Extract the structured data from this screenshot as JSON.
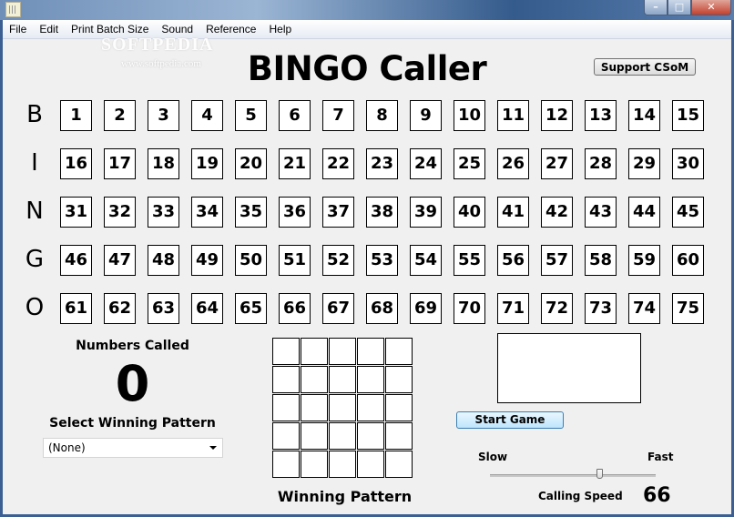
{
  "window": {
    "title_buttons": {
      "minimize": "–",
      "maximize": "□",
      "close": "✕"
    }
  },
  "watermark": {
    "brand": "SOFTPEDIA",
    "url": "www.softpedia.com"
  },
  "menu": [
    "File",
    "Edit",
    "Print Batch Size",
    "Sound",
    "Reference",
    "Help"
  ],
  "header": {
    "title": "BINGO Caller",
    "support_button": "Support CSoM"
  },
  "board": {
    "rows": [
      {
        "letter": "B",
        "numbers": [
          1,
          2,
          3,
          4,
          5,
          6,
          7,
          8,
          9,
          10,
          11,
          12,
          13,
          14,
          15
        ]
      },
      {
        "letter": "I",
        "numbers": [
          16,
          17,
          18,
          19,
          20,
          21,
          22,
          23,
          24,
          25,
          26,
          27,
          28,
          29,
          30
        ]
      },
      {
        "letter": "N",
        "numbers": [
          31,
          32,
          33,
          34,
          35,
          36,
          37,
          38,
          39,
          40,
          41,
          42,
          43,
          44,
          45
        ]
      },
      {
        "letter": "G",
        "numbers": [
          46,
          47,
          48,
          49,
          50,
          51,
          52,
          53,
          54,
          55,
          56,
          57,
          58,
          59,
          60
        ]
      },
      {
        "letter": "O",
        "numbers": [
          61,
          62,
          63,
          64,
          65,
          66,
          67,
          68,
          69,
          70,
          71,
          72,
          73,
          74,
          75
        ]
      }
    ]
  },
  "numbers_called": {
    "label": "Numbers Called",
    "value": "0"
  },
  "winning_pattern": {
    "select_label": "Select Winning Pattern",
    "selected": "(None)",
    "grid_label": "Winning Pattern",
    "grid_size": 5
  },
  "controls": {
    "current_call": "",
    "start_button": "Start Game",
    "speed_min_label": "Slow",
    "speed_max_label": "Fast",
    "speed_label": "Calling Speed",
    "speed_value": "66",
    "speed_fraction": 0.66
  }
}
